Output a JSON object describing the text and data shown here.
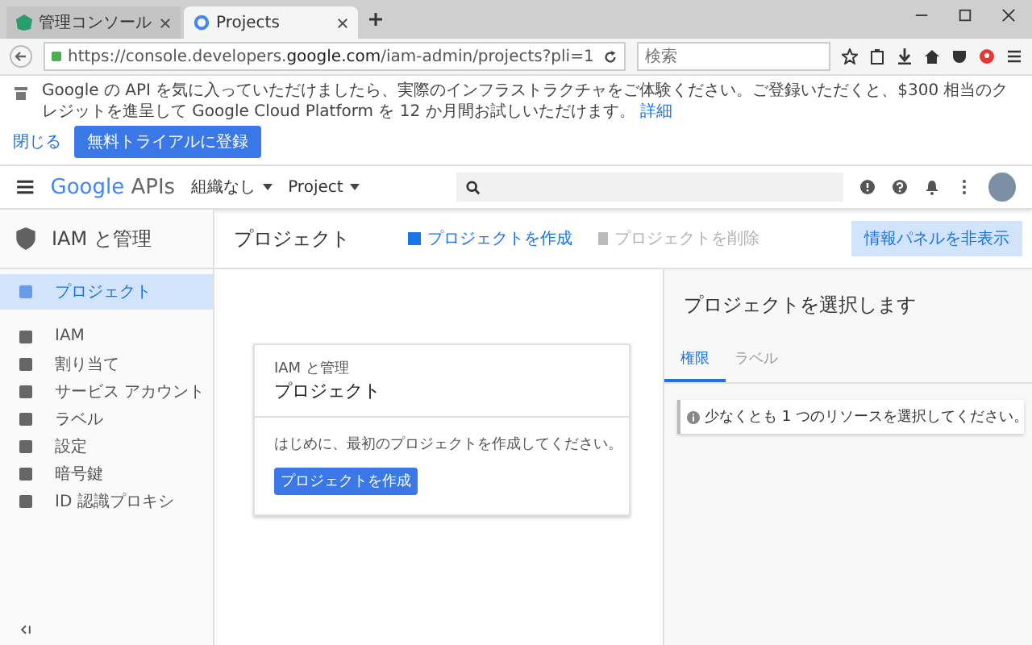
{
  "browser": {
    "tabs": [
      {
        "title": "管理コンソール",
        "selected": false
      },
      {
        "title": "Projects",
        "selected": true
      }
    ],
    "url_prefix": "https://console.developers.",
    "url_domain": "google.com",
    "url_path": "/iam-admin/projects?pli=1",
    "search": {
      "placeholder": "検索"
    }
  },
  "banner": {
    "text": "Google の API を気に入っていただけましたら、実際のインフラストラクチャをご体験ください。ご登録いただくと、$300 相当のクレジットを進呈して Google Cloud Platform を 12 か月間お試しいただけます。",
    "link": "詳細",
    "close": "閉じる",
    "signup": "無料トライアルに登録"
  },
  "appbar": {
    "logo_google": "Google",
    "logo_apis": "APIs",
    "org": "組織なし",
    "project": "Project"
  },
  "sidebar": {
    "title": "IAM と管理",
    "items": [
      {
        "label": "プロジェクト",
        "selected": true
      },
      {
        "label": "IAM",
        "selected": false
      },
      {
        "label": "割り当て",
        "selected": false
      },
      {
        "label": "サービス アカウント",
        "selected": false
      },
      {
        "label": "ラベル",
        "selected": false
      },
      {
        "label": "設定",
        "selected": false
      },
      {
        "label": "暗号鍵",
        "selected": false
      },
      {
        "label": "ID 認識プロキシ",
        "selected": false
      }
    ]
  },
  "toolbar": {
    "title": "プロジェクト",
    "create": "プロジェクトを作成",
    "delete": {
      "label": "プロジェクトを削除",
      "disabled": true
    },
    "hide_panel": "情報パネルを非表示"
  },
  "card": {
    "subtitle": "IAM と管理",
    "title": "プロジェクト",
    "text": "はじめに、最初のプロジェクトを作成してください。",
    "button": "プロジェクトを作成"
  },
  "panel": {
    "title": "プロジェクトを選択します",
    "tabs": [
      {
        "label": "権限",
        "selected": true
      },
      {
        "label": "ラベル",
        "selected": false
      }
    ],
    "notice": "少なくとも 1 つのリソースを選択してください。"
  }
}
